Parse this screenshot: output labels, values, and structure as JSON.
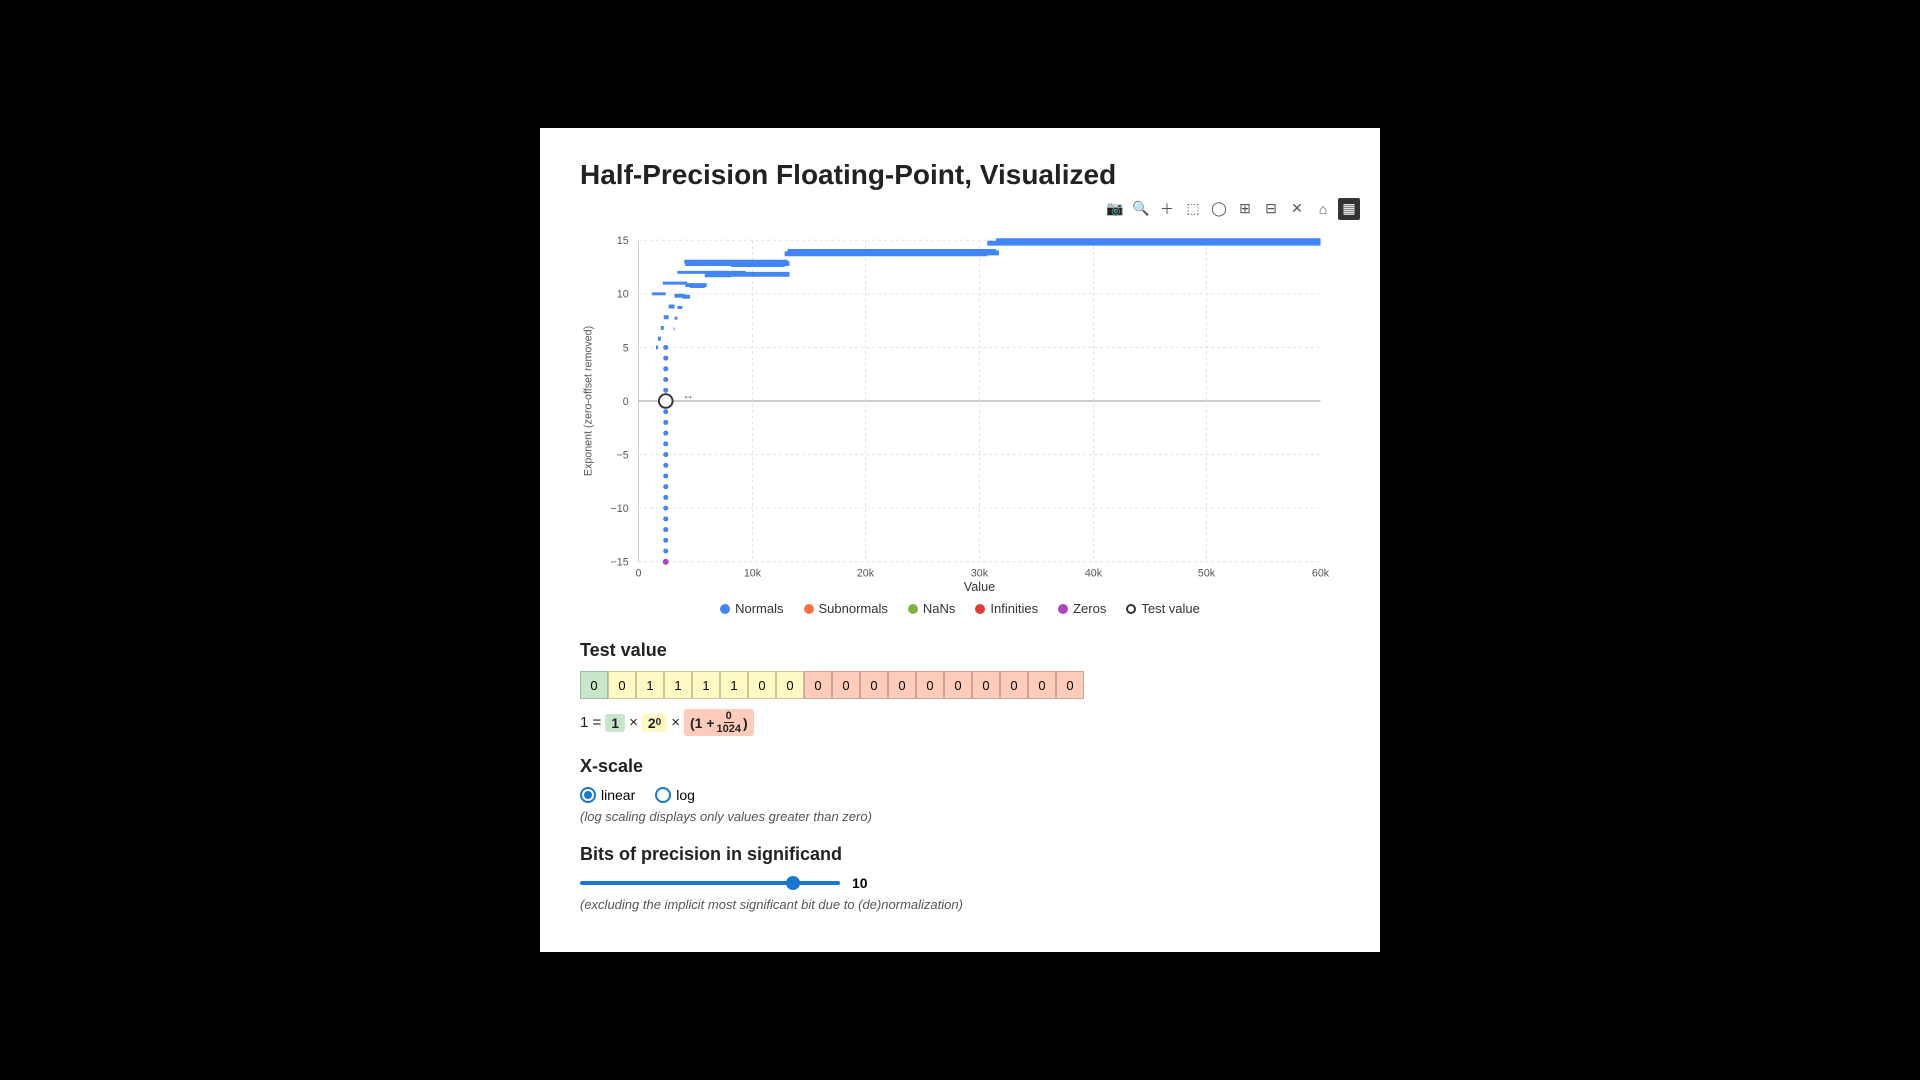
{
  "page": {
    "title": "Half-Precision Floating-Point, Visualized",
    "background": "#fff"
  },
  "toolbar": {
    "icons": [
      "📷",
      "🔍+",
      "✛",
      "⊞",
      "💬",
      "🔲",
      "🏠",
      "✕",
      "⊟",
      "📊"
    ]
  },
  "chart": {
    "x_label": "Value",
    "y_label": "Exponent (zero-offset removed)",
    "x_axis": [
      "0",
      "10k",
      "20k",
      "30k",
      "40k",
      "50k",
      "60k"
    ],
    "y_axis": [
      "15",
      "10",
      "5",
      "0",
      "-5",
      "-10",
      "-15"
    ]
  },
  "legend": {
    "items": [
      {
        "label": "Normals",
        "color": "#4285f4",
        "type": "dot"
      },
      {
        "label": "Subnormals",
        "color": "#ff7043",
        "type": "dot"
      },
      {
        "label": "NaNs",
        "color": "#7cb342",
        "type": "dot"
      },
      {
        "label": "Infinities",
        "color": "#e53935",
        "type": "dot"
      },
      {
        "label": "Zeros",
        "color": "#ab47bc",
        "type": "dot"
      },
      {
        "label": "Test value",
        "color": "#333",
        "type": "circle"
      }
    ]
  },
  "test_value": {
    "label": "Test value",
    "bits_sign": [
      "0"
    ],
    "bits_exp": [
      "0",
      "1",
      "1",
      "1",
      "1",
      "0",
      "0"
    ],
    "bits_man": [
      "0",
      "0",
      "0",
      "0",
      "0",
      "0",
      "0",
      "0",
      "0",
      "0"
    ],
    "formula_text": "1 = 1 × 2⁰ × (1 + 0/1024)"
  },
  "xscale": {
    "label": "X-scale",
    "options": [
      {
        "value": "linear",
        "label": "linear",
        "selected": true
      },
      {
        "value": "log",
        "label": "log",
        "selected": false
      }
    ],
    "note": "(log scaling displays only values greater than zero)"
  },
  "precision": {
    "label": "Bits of precision in significand",
    "value": 10,
    "min": 1,
    "max": 10,
    "note": "(excluding the implicit most significant bit due to (de)normalization)"
  }
}
